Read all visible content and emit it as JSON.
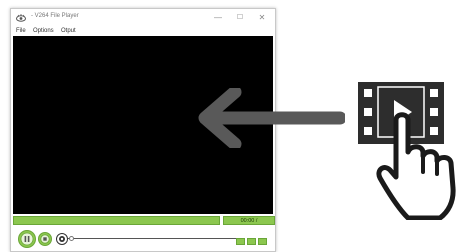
{
  "window": {
    "title": "- V264 File Player",
    "minimize_glyph": "—",
    "maximize_glyph": "☐",
    "close_glyph": "✕"
  },
  "menu": {
    "file": "File",
    "options": "Options",
    "output": "Otput"
  },
  "player": {
    "time": "00:00 /"
  },
  "icons": {
    "app": "eye-icon",
    "arrow": "left-arrow-icon",
    "media": "film-play-hand-icon"
  },
  "colors": {
    "accent": "#8cc74f",
    "video_bg": "#000000",
    "arrow": "#595959"
  }
}
